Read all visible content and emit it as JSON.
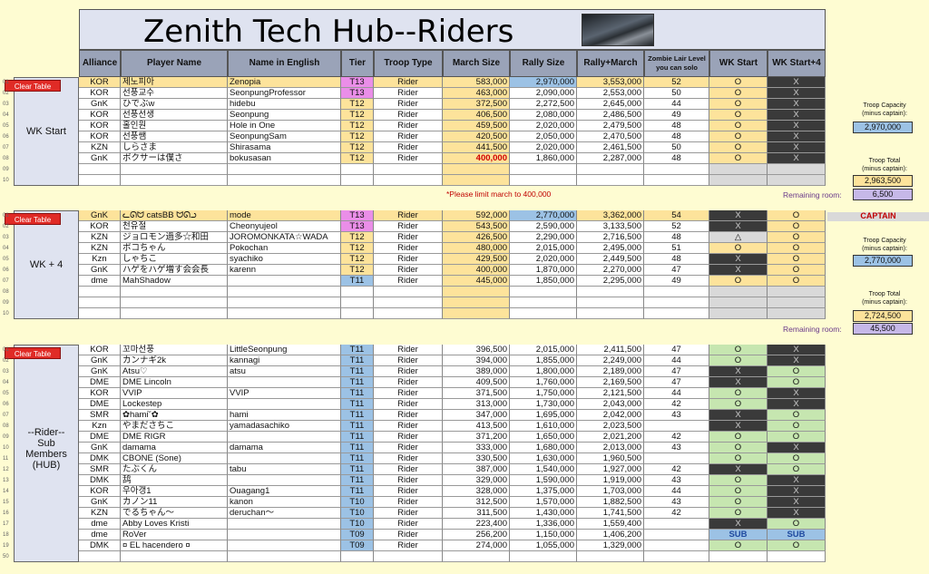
{
  "title": "Zenith Tech Hub--Riders",
  "columns": [
    "Alliance",
    "Player Name",
    "Name in English",
    "Tier",
    "Troop Type",
    "March Size",
    "Rally Size",
    "Rally+March",
    "Zombie Lair Level you can solo",
    "WK Start",
    "WK Start+4"
  ],
  "clear_label": "Clear Table",
  "sections": [
    {
      "label": "WK Start",
      "rows": [
        [
          "01",
          "KOR",
          "제노피아",
          "Zenopia",
          "T13",
          "Rider",
          "583,000",
          "2,970,000",
          "3,553,000",
          "52",
          "O",
          "X"
        ],
        [
          "02",
          "KOR",
          "선풍교수",
          "SeonpungProfessor",
          "T13",
          "Rider",
          "463,000",
          "2,090,000",
          "2,553,000",
          "50",
          "O",
          "X"
        ],
        [
          "03",
          "GnK",
          "ひでぶw",
          "hidebu",
          "T12",
          "Rider",
          "372,500",
          "2,272,500",
          "2,645,000",
          "44",
          "O",
          "X"
        ],
        [
          "04",
          "KOR",
          "선풍선생",
          "Seonpung",
          "T12",
          "Rider",
          "406,500",
          "2,080,000",
          "2,486,500",
          "49",
          "O",
          "X"
        ],
        [
          "05",
          "KOR",
          "홀인원",
          "Hole in One",
          "T12",
          "Rider",
          "459,500",
          "2,020,000",
          "2,479,500",
          "48",
          "O",
          "X"
        ],
        [
          "06",
          "KOR",
          "선풍쌤",
          "SeonpungSam",
          "T12",
          "Rider",
          "420,500",
          "2,050,000",
          "2,470,500",
          "48",
          "O",
          "X"
        ],
        [
          "07",
          "KZN",
          "しらさま",
          "Shirasama",
          "T12",
          "Rider",
          "441,500",
          "2,020,000",
          "2,461,500",
          "50",
          "O",
          "X"
        ],
        [
          "08",
          "GnK",
          "ボクサーは僕さ",
          "bokusasan",
          "T12",
          "Rider",
          "400,000",
          "1,860,000",
          "2,287,000",
          "48",
          "O",
          "X"
        ],
        [
          "09",
          "",
          "",
          "",
          "",
          "",
          "",
          "",
          "",
          "",
          "",
          ""
        ],
        [
          "10",
          "",
          "",
          "",
          "",
          "",
          "",
          "",
          "",
          "",
          "",
          ""
        ]
      ]
    },
    {
      "label": "WK + 4",
      "rows": [
        [
          "01",
          "GnK",
          "ᓚᘏᗢ catsBB ᗢᘏᓗ",
          "mode",
          "T13",
          "Rider",
          "592,000",
          "2,770,000",
          "3,362,000",
          "54",
          "X",
          "O"
        ],
        [
          "02",
          "KOR",
          "천유절",
          "Cheonyujeol",
          "T13",
          "Rider",
          "543,500",
          "2,590,000",
          "3,133,500",
          "52",
          "X",
          "O"
        ],
        [
          "03",
          "KZN",
          "ジョロモン過多☆和田",
          "JOROMONKATA☆WADA",
          "T12",
          "Rider",
          "426,500",
          "2,290,000",
          "2,716,500",
          "48",
          "△",
          "O"
        ],
        [
          "04",
          "KZN",
          "ポコちゃん",
          "Pokochan",
          "T12",
          "Rider",
          "480,000",
          "2,015,000",
          "2,495,000",
          "51",
          "O",
          "O"
        ],
        [
          "05",
          "Kzn",
          "しゃちこ",
          "syachiko",
          "T12",
          "Rider",
          "429,500",
          "2,020,000",
          "2,449,500",
          "48",
          "X",
          "O"
        ],
        [
          "06",
          "GnK",
          "ハゲをハゲ増す会会長",
          "karenn",
          "T12",
          "Rider",
          "400,000",
          "1,870,000",
          "2,270,000",
          "47",
          "X",
          "O"
        ],
        [
          "07",
          "dme",
          "MahShadow",
          "",
          "T11",
          "Rider",
          "445,000",
          "1,850,000",
          "2,295,000",
          "49",
          "O",
          "O"
        ],
        [
          "08",
          "",
          "",
          "",
          "",
          "",
          "",
          "",
          "",
          "",
          "",
          ""
        ],
        [
          "09",
          "",
          "",
          "",
          "",
          "",
          "",
          "",
          "",
          "",
          "",
          ""
        ],
        [
          "10",
          "",
          "",
          "",
          "",
          "",
          "",
          "",
          "",
          "",
          "",
          ""
        ]
      ]
    },
    {
      "label": "--Rider--\nSub\nMembers\n(HUB)",
      "rows": [
        [
          "01",
          "KOR",
          "꼬마선풍",
          "LittleSeonpung",
          "T11",
          "Rider",
          "396,500",
          "2,015,000",
          "2,411,500",
          "47",
          "O",
          "X"
        ],
        [
          "02",
          "GnK",
          "カンナギ2k",
          "kannagi",
          "T11",
          "Rider",
          "394,000",
          "1,855,000",
          "2,249,000",
          "44",
          "O",
          "X"
        ],
        [
          "03",
          "GnK",
          "Atsu♡",
          "atsu",
          "T11",
          "Rider",
          "389,000",
          "1,800,000",
          "2,189,000",
          "47",
          "X",
          "O"
        ],
        [
          "04",
          "DME",
          "DME Lincoln",
          "",
          "T11",
          "Rider",
          "409,500",
          "1,760,000",
          "2,169,500",
          "47",
          "X",
          "O"
        ],
        [
          "05",
          "KOR",
          "VVIP",
          "VVIP",
          "T11",
          "Rider",
          "371,500",
          "1,750,000",
          "2,121,500",
          "44",
          "O",
          "X"
        ],
        [
          "06",
          "DME",
          "Lockestep",
          "",
          "T11",
          "Rider",
          "313,000",
          "1,730,000",
          "2,043,000",
          "42",
          "O",
          "X"
        ],
        [
          "07",
          "SMR",
          "✿hami˘✿",
          "hami",
          "T11",
          "Rider",
          "347,000",
          "1,695,000",
          "2,042,000",
          "43",
          "X",
          "O"
        ],
        [
          "08",
          "Kzn",
          "やまださちこ",
          "yamadasachiko",
          "T11",
          "Rider",
          "413,500",
          "1,610,000",
          "2,023,500",
          "",
          "X",
          "O"
        ],
        [
          "09",
          "DME",
          "DME RIGR",
          "",
          "T11",
          "Rider",
          "371,200",
          "1,650,000",
          "2,021,200",
          "42",
          "O",
          "O"
        ],
        [
          "10",
          "GnK",
          "damama",
          "damama",
          "T11",
          "Rider",
          "333,000",
          "1,680,000",
          "2,013,000",
          "43",
          "O",
          "X"
        ],
        [
          "11",
          "DMK",
          "CBONE (Sone)",
          "",
          "T11",
          "Rider",
          "330,500",
          "1,630,000",
          "1,960,500",
          "",
          "O",
          "O"
        ],
        [
          "12",
          "SMR",
          "たぶくん",
          "tabu",
          "T11",
          "Rider",
          "387,000",
          "1,540,000",
          "1,927,000",
          "42",
          "X",
          "O"
        ],
        [
          "13",
          "DMK",
          "鸹",
          "",
          "T11",
          "Rider",
          "329,000",
          "1,590,000",
          "1,919,000",
          "43",
          "O",
          "X"
        ],
        [
          "14",
          "KOR",
          "우아갱1",
          "Ouagang1",
          "T11",
          "Rider",
          "328,000",
          "1,375,000",
          "1,703,000",
          "44",
          "O",
          "X"
        ],
        [
          "15",
          "GnK",
          "カノン11",
          "kanon",
          "T10",
          "Rider",
          "312,500",
          "1,570,000",
          "1,882,500",
          "43",
          "O",
          "X"
        ],
        [
          "16",
          "KZN",
          "でるちゃん～",
          "deruchan〜",
          "T10",
          "Rider",
          "311,500",
          "1,430,000",
          "1,741,500",
          "42",
          "O",
          "X"
        ],
        [
          "17",
          "dme",
          "Abby Loves Kristi",
          "",
          "T10",
          "Rider",
          "223,400",
          "1,336,000",
          "1,559,400",
          "",
          "X",
          "O"
        ],
        [
          "18",
          "dme",
          "RoVer",
          "",
          "T09",
          "Rider",
          "256,200",
          "1,150,000",
          "1,406,200",
          "",
          "SUB",
          "SUB"
        ],
        [
          "19",
          "DMK",
          "¤ EL hacendero ¤",
          "",
          "T09",
          "Rider",
          "274,000",
          "1,055,000",
          "1,329,000",
          "",
          "O",
          "O"
        ],
        [
          "50",
          "",
          "",
          "",
          "",
          "",
          "",
          "",
          "",
          "",
          "",
          ""
        ]
      ]
    }
  ],
  "side_panel": {
    "cap1_label": "Troop Capacity\n(minus captain):",
    "cap1_value": "2,970,000",
    "total1_label": "Troop Total\n(minus captain):",
    "total1_value": "2,963,500",
    "remaining_label": "Remaining room:",
    "remaining1_value": "6,500",
    "captain_label": "CAPTAIN",
    "cap2_label": "Troop Capacity\n(minus captain):",
    "cap2_value": "2,770,000",
    "total2_label": "Troop Total\n(minus captain):",
    "total2_value": "2,724,500",
    "remaining2_value": "45,500"
  },
  "limit_note": "*Please limit march to 400,000",
  "colors": {
    "tier_t13": "#ea8ee8",
    "tier_t12": "#fde39b",
    "tier_t11": "#9cc2e5",
    "o_green": "#c6e6b0",
    "x_dark": "#3a3a3a",
    "yellow": "#fde39b",
    "blue_box": "#9cc2e5",
    "purple_box": "#c6b8e8"
  }
}
